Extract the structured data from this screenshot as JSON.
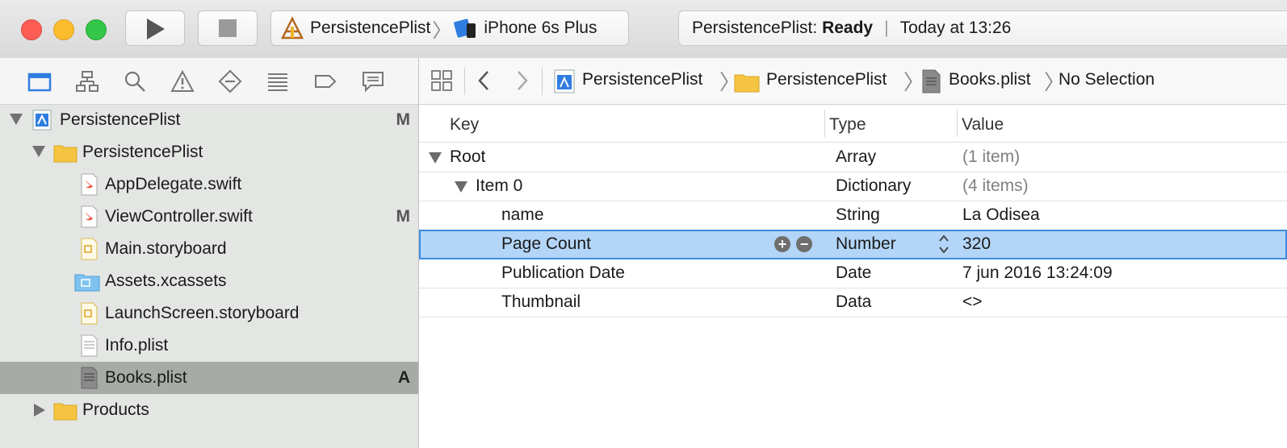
{
  "toolbar": {
    "scheme_project": "PersistencePlist",
    "scheme_device": "iPhone 6s Plus",
    "status_project": "PersistencePlist:",
    "status_state": "Ready",
    "status_time": "Today at 13:26"
  },
  "navigator": {
    "items": [
      {
        "label": "PersistencePlist",
        "badge": "M"
      },
      {
        "label": "PersistencePlist",
        "badge": ""
      },
      {
        "label": "AppDelegate.swift",
        "badge": ""
      },
      {
        "label": "ViewController.swift",
        "badge": "M"
      },
      {
        "label": "Main.storyboard",
        "badge": ""
      },
      {
        "label": "Assets.xcassets",
        "badge": ""
      },
      {
        "label": "LaunchScreen.storyboard",
        "badge": ""
      },
      {
        "label": "Info.plist",
        "badge": ""
      },
      {
        "label": "Books.plist",
        "badge": "A"
      },
      {
        "label": "Products",
        "badge": ""
      }
    ]
  },
  "jumpbar": {
    "project": "PersistencePlist",
    "group": "PersistencePlist",
    "file": "Books.plist",
    "selection": "No Selection"
  },
  "plist": {
    "headers": {
      "key": "Key",
      "type": "Type",
      "value": "Value"
    },
    "rows": [
      {
        "key": "Root",
        "type": "Array",
        "value": "(1 item)"
      },
      {
        "key": "Item 0",
        "type": "Dictionary",
        "value": "(4 items)"
      },
      {
        "key": "name",
        "type": "String",
        "value": "La Odisea"
      },
      {
        "key": "Page Count",
        "type": "Number",
        "value": "320"
      },
      {
        "key": "Publication Date",
        "type": "Date",
        "value": "7 jun 2016 13:24:09"
      },
      {
        "key": "Thumbnail",
        "type": "Data",
        "value": "<>"
      }
    ]
  },
  "colors": {
    "selection_blue": "#b3d5f7",
    "navigator_selection": "#a7aba5",
    "accent_blue": "#2f7de0"
  }
}
